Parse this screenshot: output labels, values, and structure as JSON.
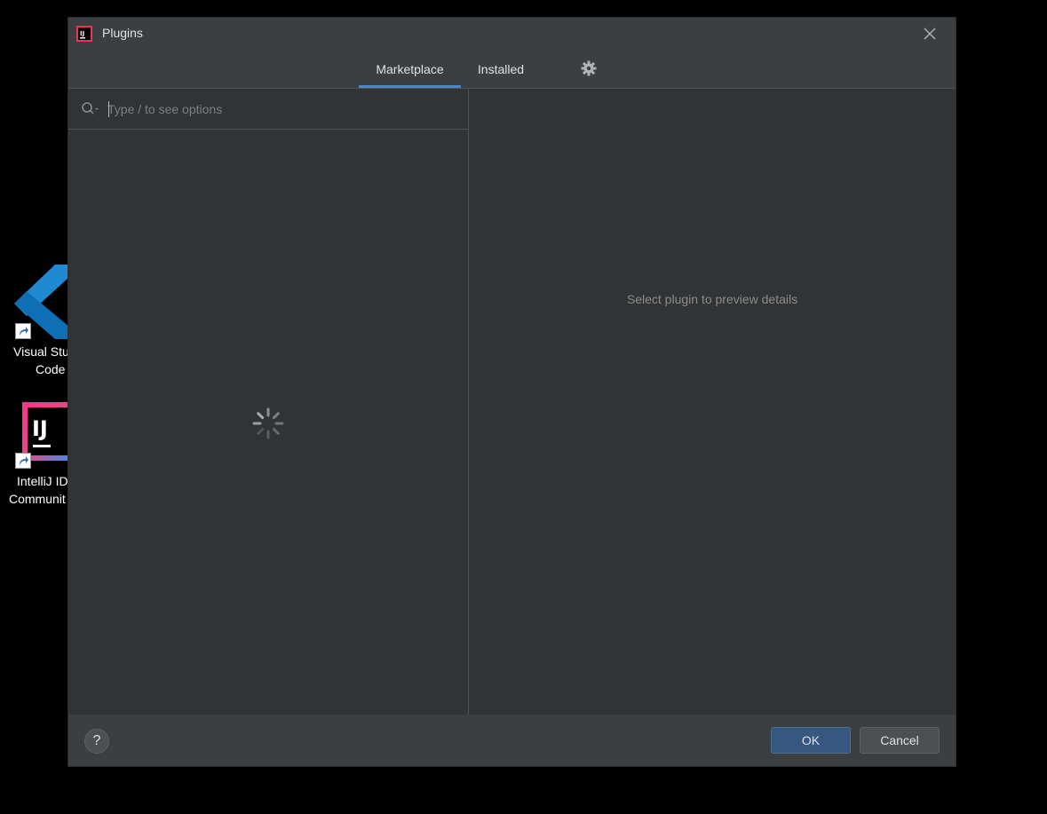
{
  "desktop": {
    "icons": [
      {
        "label_line1": "Visual Stu",
        "label_line2": "Code"
      },
      {
        "label_line1": "IntelliJ ID",
        "label_line2": "Communit"
      }
    ]
  },
  "dialog": {
    "title": "Plugins",
    "tabs": [
      {
        "label": "Marketplace",
        "active": true
      },
      {
        "label": "Installed",
        "active": false
      }
    ],
    "search": {
      "placeholder": "Type / to see options",
      "value": ""
    },
    "preview_empty_text": "Select plugin to preview details",
    "help_label": "?",
    "ok_label": "OK",
    "cancel_label": "Cancel"
  },
  "colors": {
    "accent": "#4a88c7",
    "dialog_bg": "#3c3f41",
    "pane_bg": "#313335",
    "ok_button": "#365880"
  },
  "icons": [
    "plugins-app-icon",
    "close-icon",
    "gear-icon",
    "search-icon",
    "loading-spinner-icon",
    "help-icon"
  ]
}
